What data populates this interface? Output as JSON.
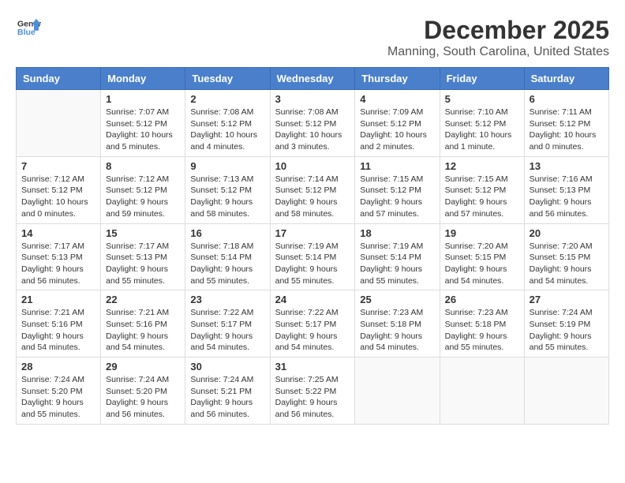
{
  "logo": {
    "general": "General",
    "blue": "Blue"
  },
  "header": {
    "month": "December 2025",
    "location": "Manning, South Carolina, United States"
  },
  "weekdays": [
    "Sunday",
    "Monday",
    "Tuesday",
    "Wednesday",
    "Thursday",
    "Friday",
    "Saturday"
  ],
  "weeks": [
    [
      {
        "day": "",
        "info": ""
      },
      {
        "day": "1",
        "info": "Sunrise: 7:07 AM\nSunset: 5:12 PM\nDaylight: 10 hours\nand 5 minutes."
      },
      {
        "day": "2",
        "info": "Sunrise: 7:08 AM\nSunset: 5:12 PM\nDaylight: 10 hours\nand 4 minutes."
      },
      {
        "day": "3",
        "info": "Sunrise: 7:08 AM\nSunset: 5:12 PM\nDaylight: 10 hours\nand 3 minutes."
      },
      {
        "day": "4",
        "info": "Sunrise: 7:09 AM\nSunset: 5:12 PM\nDaylight: 10 hours\nand 2 minutes."
      },
      {
        "day": "5",
        "info": "Sunrise: 7:10 AM\nSunset: 5:12 PM\nDaylight: 10 hours\nand 1 minute."
      },
      {
        "day": "6",
        "info": "Sunrise: 7:11 AM\nSunset: 5:12 PM\nDaylight: 10 hours\nand 0 minutes."
      }
    ],
    [
      {
        "day": "7",
        "info": "Sunrise: 7:12 AM\nSunset: 5:12 PM\nDaylight: 10 hours\nand 0 minutes."
      },
      {
        "day": "8",
        "info": "Sunrise: 7:12 AM\nSunset: 5:12 PM\nDaylight: 9 hours\nand 59 minutes."
      },
      {
        "day": "9",
        "info": "Sunrise: 7:13 AM\nSunset: 5:12 PM\nDaylight: 9 hours\nand 58 minutes."
      },
      {
        "day": "10",
        "info": "Sunrise: 7:14 AM\nSunset: 5:12 PM\nDaylight: 9 hours\nand 58 minutes."
      },
      {
        "day": "11",
        "info": "Sunrise: 7:15 AM\nSunset: 5:12 PM\nDaylight: 9 hours\nand 57 minutes."
      },
      {
        "day": "12",
        "info": "Sunrise: 7:15 AM\nSunset: 5:12 PM\nDaylight: 9 hours\nand 57 minutes."
      },
      {
        "day": "13",
        "info": "Sunrise: 7:16 AM\nSunset: 5:13 PM\nDaylight: 9 hours\nand 56 minutes."
      }
    ],
    [
      {
        "day": "14",
        "info": "Sunrise: 7:17 AM\nSunset: 5:13 PM\nDaylight: 9 hours\nand 56 minutes."
      },
      {
        "day": "15",
        "info": "Sunrise: 7:17 AM\nSunset: 5:13 PM\nDaylight: 9 hours\nand 55 minutes."
      },
      {
        "day": "16",
        "info": "Sunrise: 7:18 AM\nSunset: 5:14 PM\nDaylight: 9 hours\nand 55 minutes."
      },
      {
        "day": "17",
        "info": "Sunrise: 7:19 AM\nSunset: 5:14 PM\nDaylight: 9 hours\nand 55 minutes."
      },
      {
        "day": "18",
        "info": "Sunrise: 7:19 AM\nSunset: 5:14 PM\nDaylight: 9 hours\nand 55 minutes."
      },
      {
        "day": "19",
        "info": "Sunrise: 7:20 AM\nSunset: 5:15 PM\nDaylight: 9 hours\nand 54 minutes."
      },
      {
        "day": "20",
        "info": "Sunrise: 7:20 AM\nSunset: 5:15 PM\nDaylight: 9 hours\nand 54 minutes."
      }
    ],
    [
      {
        "day": "21",
        "info": "Sunrise: 7:21 AM\nSunset: 5:16 PM\nDaylight: 9 hours\nand 54 minutes."
      },
      {
        "day": "22",
        "info": "Sunrise: 7:21 AM\nSunset: 5:16 PM\nDaylight: 9 hours\nand 54 minutes."
      },
      {
        "day": "23",
        "info": "Sunrise: 7:22 AM\nSunset: 5:17 PM\nDaylight: 9 hours\nand 54 minutes."
      },
      {
        "day": "24",
        "info": "Sunrise: 7:22 AM\nSunset: 5:17 PM\nDaylight: 9 hours\nand 54 minutes."
      },
      {
        "day": "25",
        "info": "Sunrise: 7:23 AM\nSunset: 5:18 PM\nDaylight: 9 hours\nand 54 minutes."
      },
      {
        "day": "26",
        "info": "Sunrise: 7:23 AM\nSunset: 5:18 PM\nDaylight: 9 hours\nand 55 minutes."
      },
      {
        "day": "27",
        "info": "Sunrise: 7:24 AM\nSunset: 5:19 PM\nDaylight: 9 hours\nand 55 minutes."
      }
    ],
    [
      {
        "day": "28",
        "info": "Sunrise: 7:24 AM\nSunset: 5:20 PM\nDaylight: 9 hours\nand 55 minutes."
      },
      {
        "day": "29",
        "info": "Sunrise: 7:24 AM\nSunset: 5:20 PM\nDaylight: 9 hours\nand 56 minutes."
      },
      {
        "day": "30",
        "info": "Sunrise: 7:24 AM\nSunset: 5:21 PM\nDaylight: 9 hours\nand 56 minutes."
      },
      {
        "day": "31",
        "info": "Sunrise: 7:25 AM\nSunset: 5:22 PM\nDaylight: 9 hours\nand 56 minutes."
      },
      {
        "day": "",
        "info": ""
      },
      {
        "day": "",
        "info": ""
      },
      {
        "day": "",
        "info": ""
      }
    ]
  ]
}
